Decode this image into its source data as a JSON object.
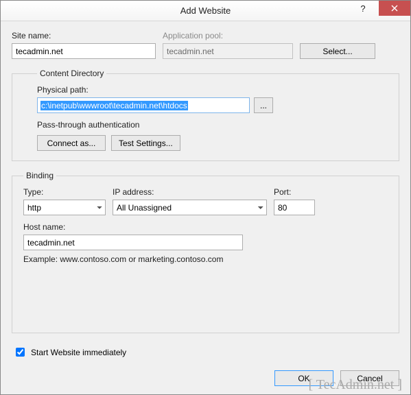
{
  "window": {
    "title": "Add Website"
  },
  "siteName": {
    "label": "Site name:",
    "value": "tecadmin.net"
  },
  "appPool": {
    "label": "Application pool:",
    "value": "tecadmin.net",
    "select": "Select..."
  },
  "content": {
    "legend": "Content Directory",
    "pathLabel": "Physical path:",
    "pathValue": "c:\\inetpub\\wwwroot\\tecadmin.net\\htdocs",
    "browse": "...",
    "passthrough": "Pass-through authentication",
    "connect": "Connect as...",
    "test": "Test Settings..."
  },
  "binding": {
    "legend": "Binding",
    "typeLabel": "Type:",
    "type": "http",
    "ipLabel": "IP address:",
    "ip": "All Unassigned",
    "portLabel": "Port:",
    "port": "80",
    "hostLabel": "Host name:",
    "host": "tecadmin.net",
    "example": "Example: www.contoso.com or marketing.contoso.com"
  },
  "startImmediately": "Start Website immediately",
  "ok": "OK",
  "cancel": "Cancel",
  "watermark": "[ TecAdmin.net ]"
}
